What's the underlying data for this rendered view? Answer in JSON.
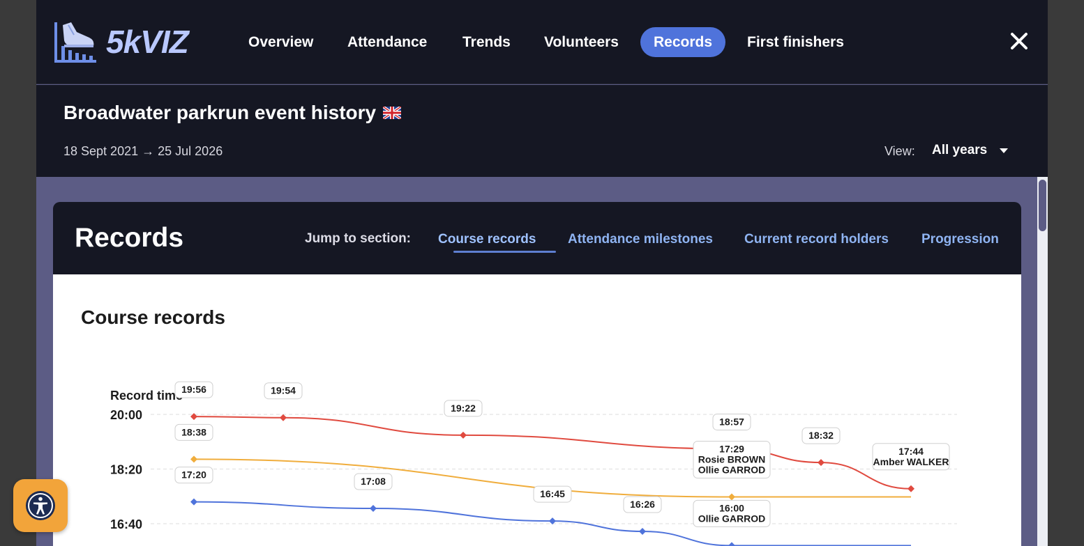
{
  "app": {
    "brand": "5kVIZ",
    "brand_color": "#b9c8ff",
    "logo_icon": "running-shoe-bar-chart-icon",
    "close_icon": "close-icon"
  },
  "nav": {
    "items": [
      {
        "label": "Overview",
        "active": false
      },
      {
        "label": "Attendance",
        "active": false
      },
      {
        "label": "Trends",
        "active": false
      },
      {
        "label": "Volunteers",
        "active": false
      },
      {
        "label": "Records",
        "active": true
      },
      {
        "label": "First finishers",
        "active": false
      }
    ],
    "active_color": "#4f73db"
  },
  "event": {
    "title": "Broadwater parkrun event history",
    "flag_icon": "uk-flag-icon",
    "start_date": "18 Sept 2021",
    "arrow": "→",
    "end_date": "25 Jul 2026",
    "view_label": "View:",
    "view_value": "All years"
  },
  "records": {
    "title": "Records",
    "jump_label": "Jump to section:",
    "links": [
      {
        "label": "Course records",
        "active": true
      },
      {
        "label": "Attendance milestones",
        "active": false
      },
      {
        "label": "Current record holders",
        "active": false
      },
      {
        "label": "Progression",
        "active": false
      }
    ]
  },
  "course_records": {
    "title": "Course records"
  },
  "chart_data": {
    "type": "line",
    "ylabel": "Record time",
    "y_ticks": [
      "20:00",
      "18:20",
      "16:40"
    ],
    "grid": true,
    "series": [
      {
        "color": "#e04a3f",
        "points": [
          {
            "x": 0,
            "y": "19:56",
            "label": "19:56"
          },
          {
            "x": 1,
            "y": "19:54",
            "label": "19:54"
          },
          {
            "x": 3,
            "y": "19:22",
            "label": "19:22"
          },
          {
            "x": 6,
            "y": "18:57",
            "label": "18:57"
          },
          {
            "x": 7,
            "y": "18:32",
            "label": "18:32"
          },
          {
            "x": 8,
            "y": "17:44",
            "label": "17:44",
            "name": "Amber WALKER"
          }
        ]
      },
      {
        "color": "#f0ad3c",
        "points": [
          {
            "x": 0,
            "y": "18:38",
            "label": "18:38"
          },
          {
            "x": 6,
            "y": "17:29",
            "label": "17:29",
            "name": "Rosie BROWN\nOllie GARROD"
          },
          {
            "x": 8,
            "y": "17:29"
          }
        ]
      },
      {
        "color": "#4f73db",
        "points": [
          {
            "x": 0,
            "y": "17:20",
            "label": "17:20"
          },
          {
            "x": 2,
            "y": "17:08",
            "label": "17:08"
          },
          {
            "x": 4,
            "y": "16:45",
            "label": "16:45"
          },
          {
            "x": 5,
            "y": "16:26",
            "label": "16:26"
          },
          {
            "x": 6,
            "y": "16:00",
            "label": "16:00",
            "name": "Ollie GARROD"
          },
          {
            "x": 8,
            "y": "16:00"
          }
        ]
      }
    ]
  },
  "accessibility": {
    "icon": "accessibility-icon"
  }
}
